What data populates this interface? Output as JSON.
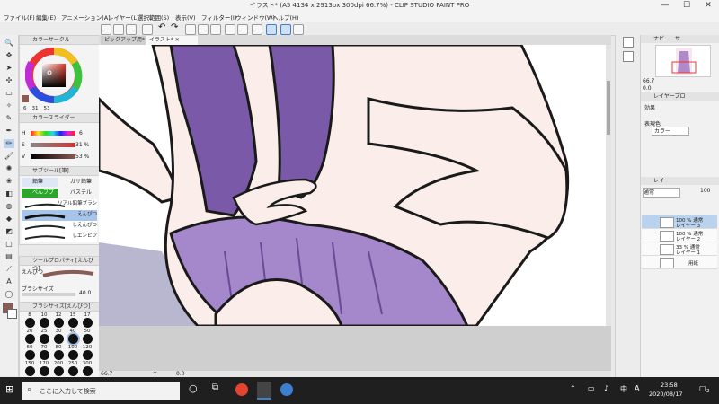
{
  "window": {
    "title": "イラスト* (A5 4134 x 2913px 300dpi 66.7%)  - CLIP STUDIO PAINT PRO",
    "minimize": "—",
    "maximize": "☐",
    "close": "✕"
  },
  "menu": [
    "ファイル(F)",
    "編集(E)",
    "アニメーション(A)",
    "レイヤー(L)",
    "選択範囲(S)",
    "表示(V)",
    "フィルター(I)",
    "ウィンドウ(W)",
    "ヘルプ(H)"
  ],
  "tabs": [
    {
      "label": "ピックアップ用*"
    },
    {
      "label": "イラスト*"
    }
  ],
  "color_circle": {
    "panel_title": "カラーサークル",
    "readout": [
      "6",
      "31",
      "53"
    ],
    "main_color": "#8a5a55",
    "sub_color": "#ffffff"
  },
  "color_slider": {
    "panel_title": "カラースライダー",
    "rows": [
      {
        "label": "H",
        "value": "6"
      },
      {
        "label": "S",
        "value": "31 %"
      },
      {
        "label": "V",
        "value": "53 %"
      }
    ]
  },
  "sub_tool": {
    "panel_title": "サブツール[筆]",
    "groups": [
      "鉛筆",
      "ガサ鉛筆",
      "べんフプラン",
      "パステル"
    ],
    "brushes": [
      "リアル鉛筆ブラシ",
      "えんぴつ",
      "しえんぴつ",
      "しエンピツ"
    ]
  },
  "tool_property": {
    "panel_title": "ツールプロパティ[えんぴつ]",
    "brush_name": "えんぴつ",
    "size_label": "ブラシサイズ",
    "size_value": "40.0"
  },
  "brush_size": {
    "panel_title": "ブラシサイズ[えんぴつ]",
    "sizes": [
      "8",
      "10",
      "12",
      "15",
      "17",
      "20",
      "25",
      "30",
      "40",
      "50",
      "60",
      "70",
      "80",
      "100",
      "120",
      "150",
      "170",
      "200",
      "250",
      "300"
    ]
  },
  "navigator": {
    "tabs": [
      "ナビ",
      "サ"
    ],
    "zoom": "66.7",
    "angle": "0.0"
  },
  "layer_property": {
    "panel_title": "レイヤープロ",
    "effect_label": "効果",
    "display_color_label": "表現色",
    "display_color_value": "カラー"
  },
  "layers": {
    "tabs": [
      "レイ"
    ],
    "blend_mode": "通常",
    "opacity": "100",
    "rows": [
      {
        "meta": "100 % 通常",
        "name": "レイヤー 3"
      },
      {
        "meta": "100 % 通常",
        "name": "レイヤー 2"
      },
      {
        "meta": "33 % 通常",
        "name": "レイヤー 1"
      },
      {
        "meta": "",
        "name": "用紙"
      }
    ]
  },
  "status": {
    "zoom": "66.7",
    "angle": "0.0"
  },
  "taskbar": {
    "search_placeholder": "ここに入力して検索",
    "ime": "A",
    "time": "23:58",
    "date": "2020/08/17",
    "notification_count": "2"
  },
  "colors": {
    "hair": "#7a5aa8",
    "skirt": "#a587cb",
    "skin": "#fbeeea",
    "outline": "#1a1a1a",
    "accent": "#3c7fd1"
  }
}
